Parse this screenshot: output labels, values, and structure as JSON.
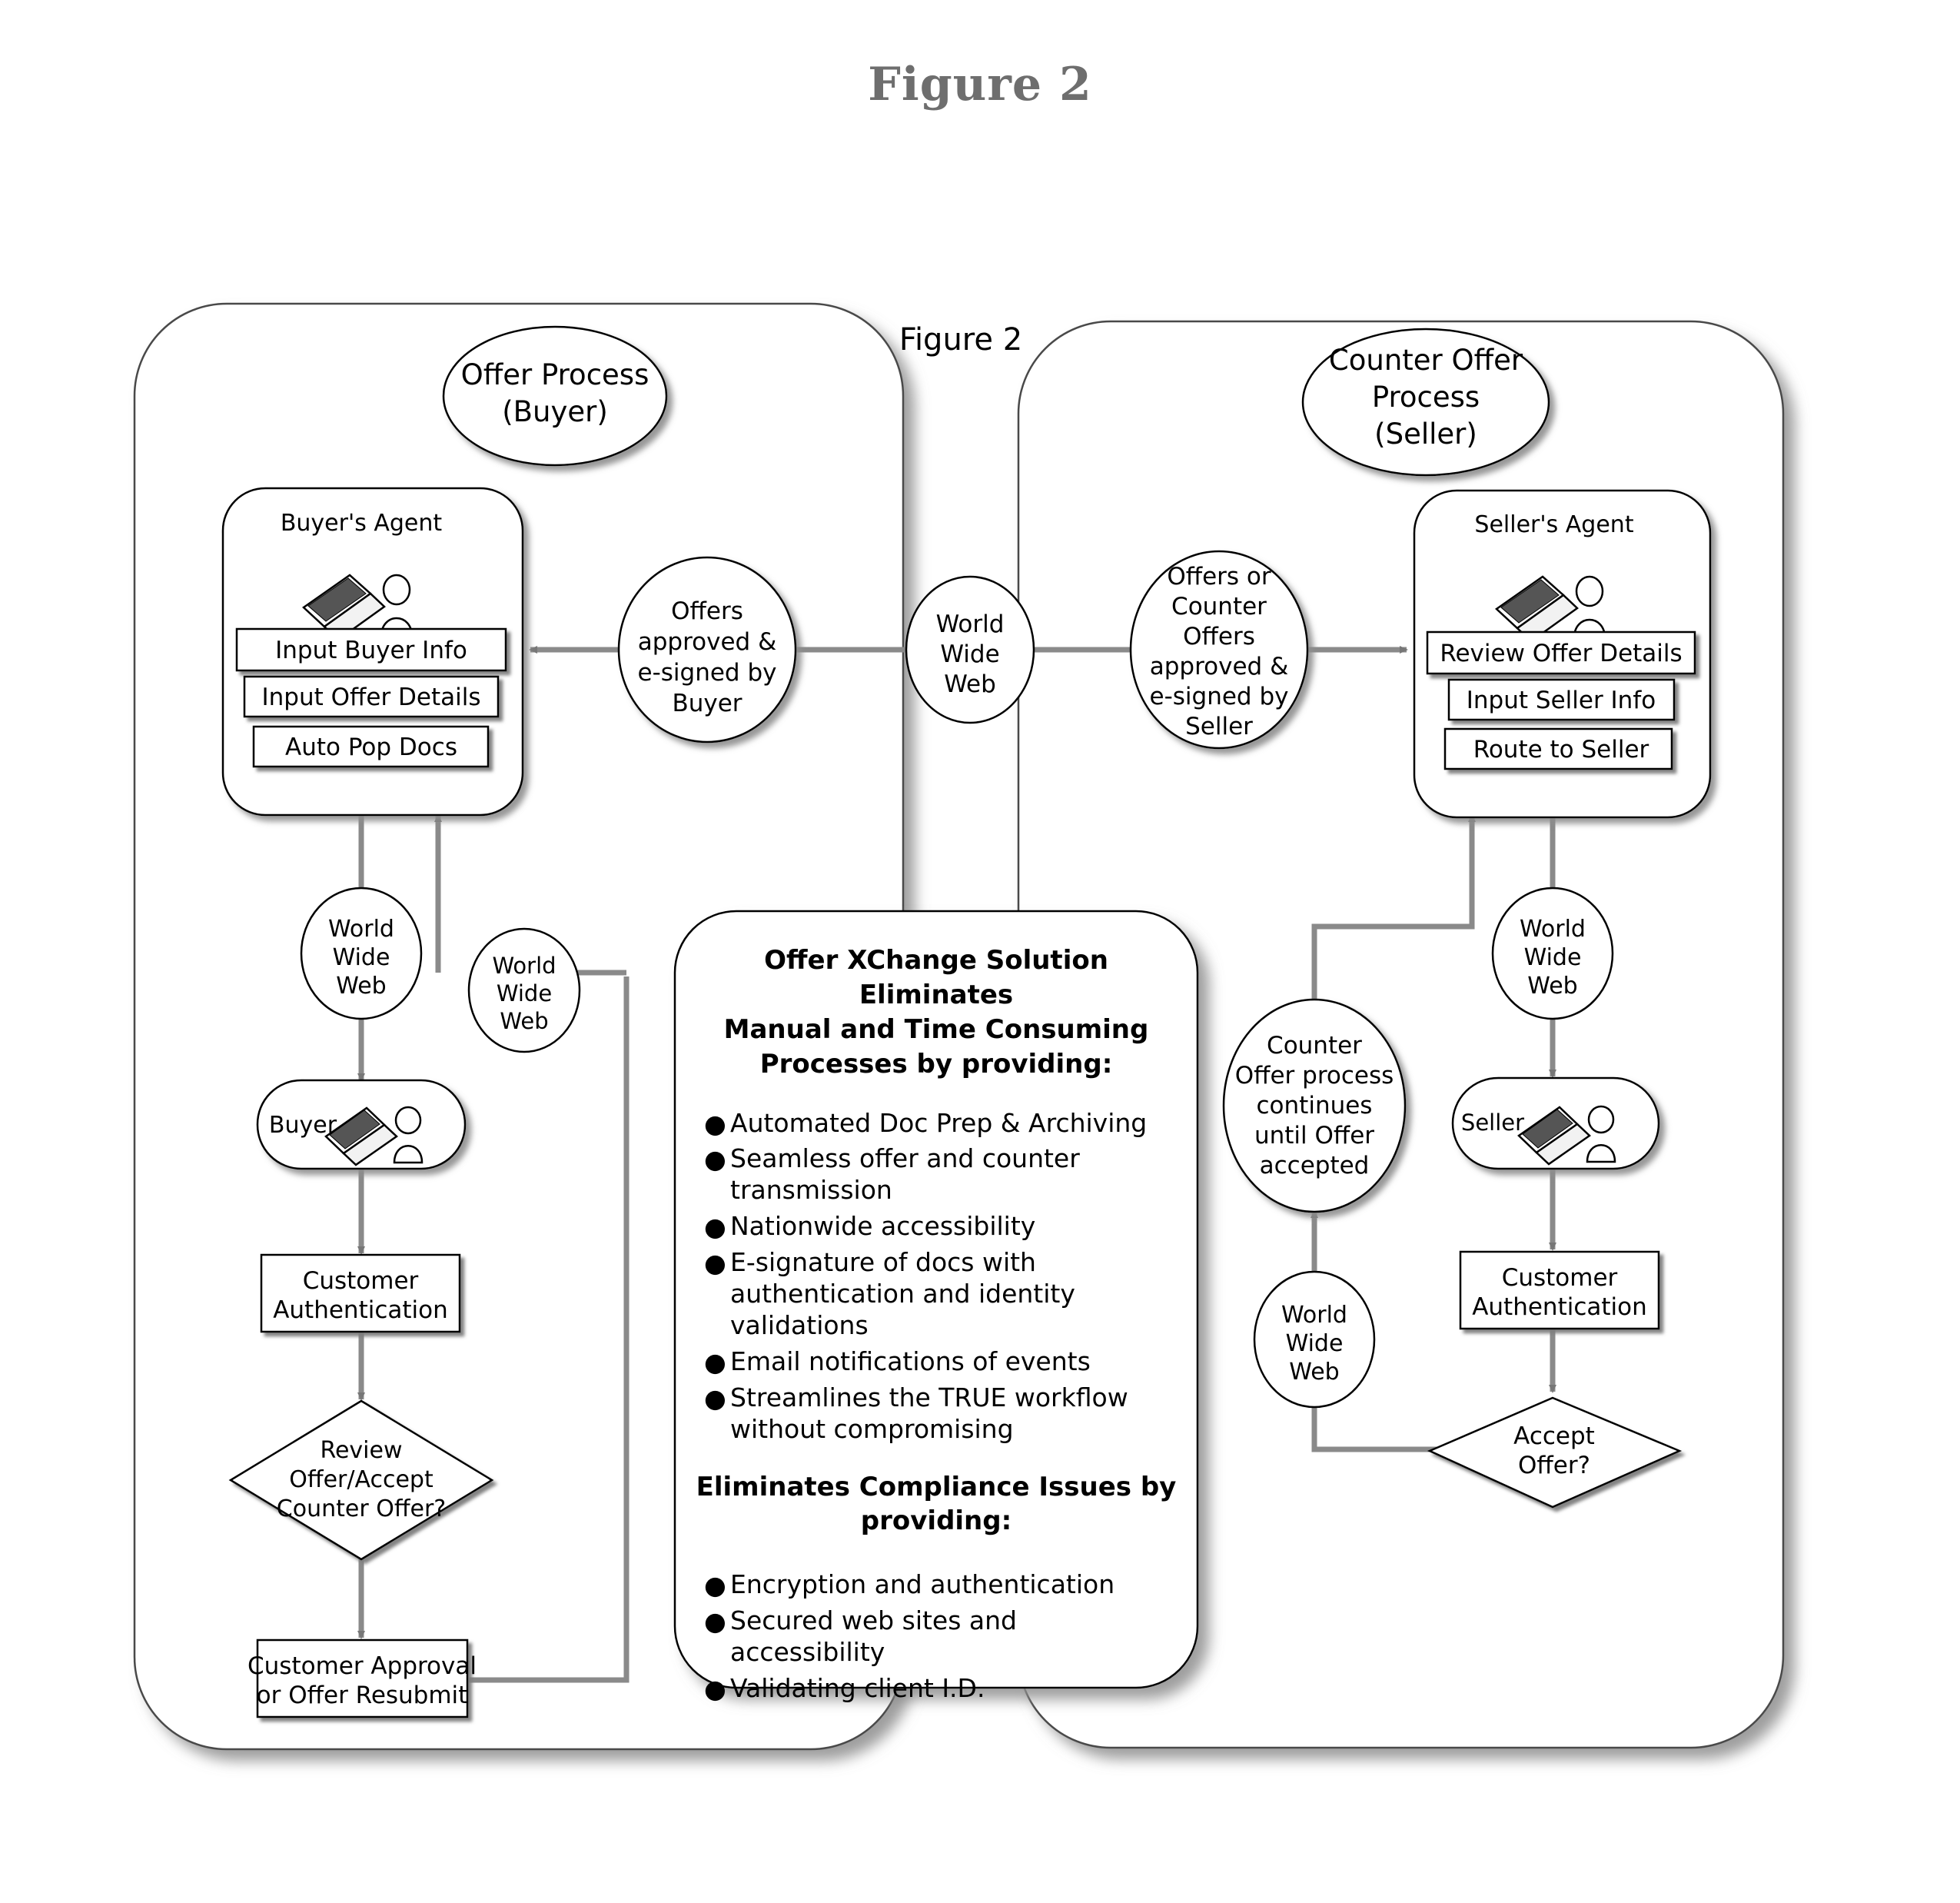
{
  "page": {
    "title": "Figure 2",
    "inner_title": "Figure 2"
  },
  "left_lane": {
    "title_line1": "Offer Process",
    "title_line2": "(Buyer)",
    "agent": {
      "heading": "Buyer's Agent",
      "actions": [
        "Input Buyer Info",
        "Input Offer Details",
        "Auto Pop Docs"
      ]
    },
    "nodes": {
      "www_1": [
        "World",
        "Wide",
        "Web"
      ],
      "www_2": [
        "World",
        "Wide",
        "Web"
      ],
      "person": "Buyer",
      "auth": [
        "Customer",
        "Authentication"
      ],
      "decision": [
        "Review",
        "Offer/Accept",
        "Counter Offer?"
      ],
      "approval": [
        "Customer Approval",
        "or Offer Resubmit"
      ]
    }
  },
  "center": {
    "offers_buyer": [
      "Offers",
      "approved &",
      "e-signed by",
      "Buyer"
    ],
    "www_hub": [
      "World",
      "Wide",
      "Web"
    ],
    "offers_seller": [
      "Offers or",
      "Counter",
      "Offers",
      "approved &",
      "e-signed by",
      "Seller"
    ]
  },
  "right_lane": {
    "title_line1": "Counter Offer",
    "title_line2": "Process",
    "title_line3": "(Seller)",
    "agent": {
      "heading": "Seller's Agent",
      "actions": [
        "Review Offer Details",
        "Input Seller Info",
        "Route to Seller"
      ]
    },
    "nodes": {
      "counter_loop": [
        "Counter",
        "Offer process",
        "continues",
        "until Offer",
        "accepted"
      ],
      "www_1": [
        "World",
        "Wide",
        "Web"
      ],
      "www_2": [
        "World",
        "Wide",
        "Web"
      ],
      "person": "Seller",
      "auth": [
        "Customer",
        "Authentication"
      ],
      "decision": [
        "Accept",
        "Offer?"
      ]
    }
  },
  "info_panel": {
    "heading1_lines": [
      "Offer XChange Solution Eliminates",
      "Manual and Time Consuming",
      "Processes by providing:"
    ],
    "bullets1": [
      "Automated Doc Prep & Archiving",
      "Seamless offer and counter transmission",
      "Nationwide accessibility",
      "E-signature of docs with authentication and identity validations",
      "Email notifications of events",
      "Streamlines the TRUE workflow without compromising"
    ],
    "heading2_lines": [
      "Eliminates Compliance Issues by",
      "providing:"
    ],
    "bullets2": [
      "Encryption and authentication",
      "Secured web sites and accessibility",
      "Validating client I.D."
    ]
  },
  "colors": {
    "title": "#6e6e6e",
    "stroke": "#000000",
    "fill": "#ffffff",
    "shadow": "#9a9a9a",
    "connector": "#808080"
  }
}
